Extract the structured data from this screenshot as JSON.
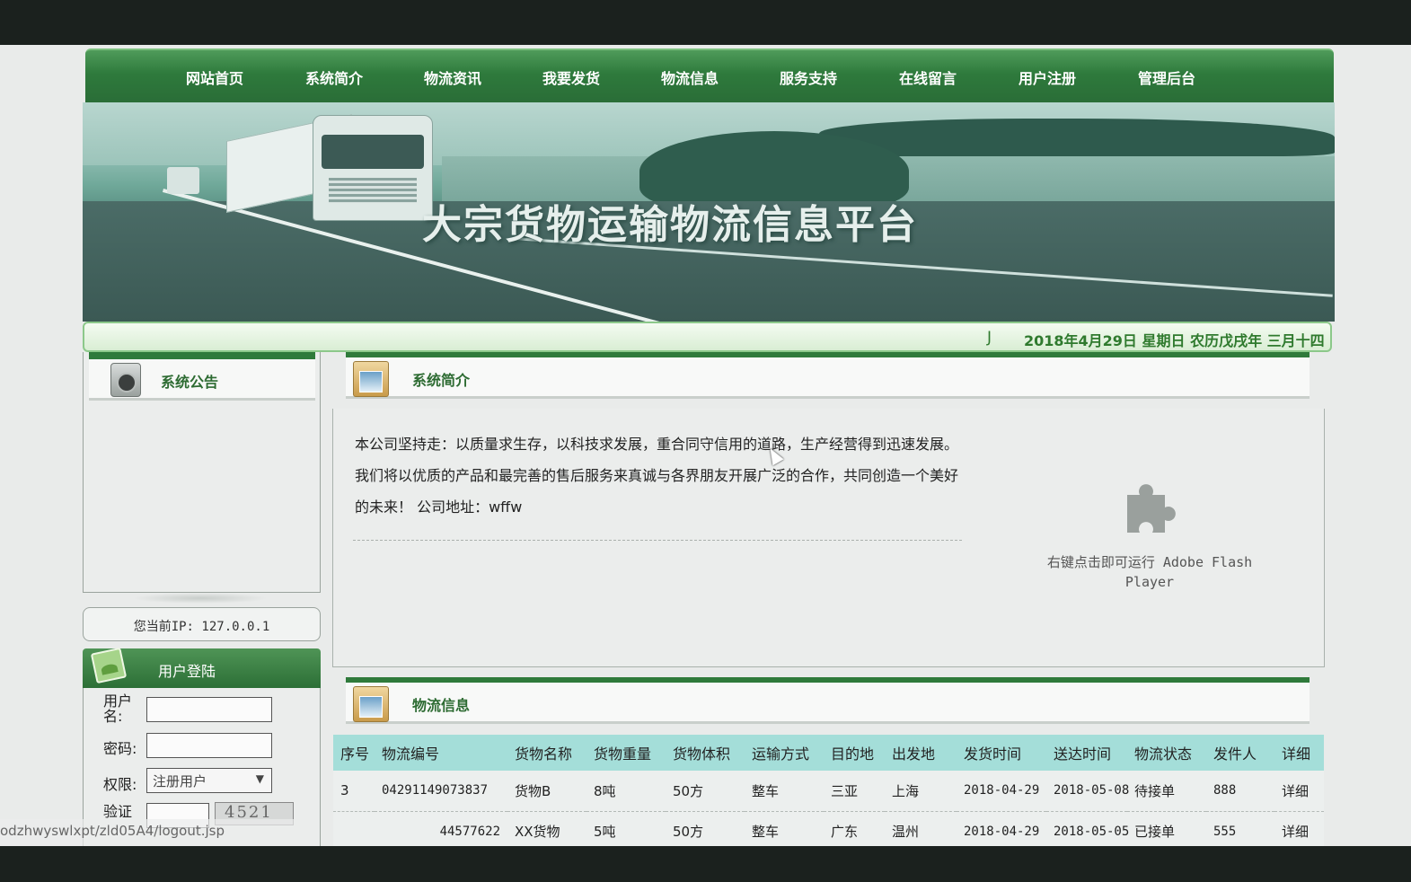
{
  "nav": {
    "items": [
      "网站首页",
      "系统简介",
      "物流资讯",
      "我要发货",
      "物流信息",
      "服务支持",
      "在线留言",
      "用户注册",
      "管理后台"
    ]
  },
  "banner": {
    "title": "大宗货物运输物流信息平台"
  },
  "datebar": {
    "marquee": "J",
    "date": "2018年4月29日 星期日 农历戊戌年 三月十四"
  },
  "notice": {
    "title": "系统公告"
  },
  "ip": {
    "text": "您当前IP: 127.0.0.1"
  },
  "login": {
    "title": "用户登陆",
    "username_label": "用户名:",
    "password_label": "密码:",
    "role_label": "权限:",
    "role_value": "注册用户",
    "captcha_label": "验证",
    "captcha_value": "4521"
  },
  "intro": {
    "title": "系统简介",
    "text": "本公司坚持走：以质量求生存，以科技求发展，重合同守信用的道路，生产经营得到迅速发展。我们将以优质的产品和最完善的售后服务来真诚与各界朋友开展广泛的合作，共同创造一个美好的未来！ 公司地址：wffw",
    "flash_text": "右键点击即可运行 Adobe Flash Player"
  },
  "logistics": {
    "title": "物流信息",
    "columns": [
      "序号",
      "物流编号",
      "货物名称",
      "货物重量",
      "货物体积",
      "运输方式",
      "目的地",
      "出发地",
      "发货时间",
      "送达时间",
      "物流状态",
      "发件人",
      "详细"
    ],
    "rows": [
      [
        "3",
        "04291149073837",
        "货物B",
        "8吨",
        "50方",
        "整车",
        "三亚",
        "上海",
        "2018-04-29",
        "2018-05-08",
        "待接单",
        "888",
        "详细"
      ],
      [
        "",
        "44577622",
        "XX货物",
        "5吨",
        "50方",
        "整车",
        "广东",
        "温州",
        "2018-04-29",
        "2018-05-05",
        "已接单",
        "555",
        "详细"
      ]
    ]
  },
  "statusbar": {
    "text": "odzhwyswlxpt/zld05A4/logout.jsp"
  }
}
